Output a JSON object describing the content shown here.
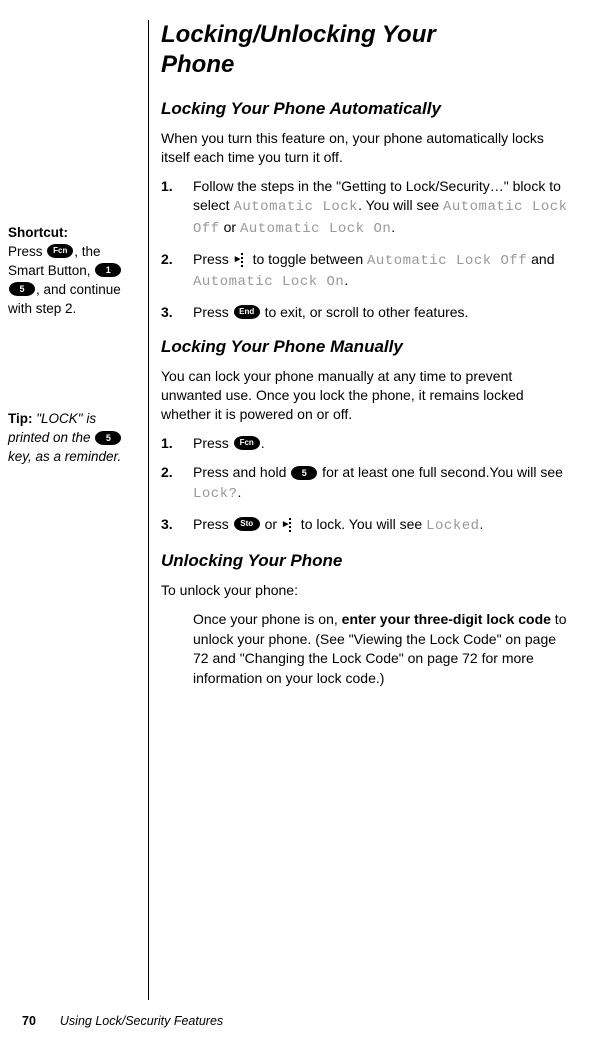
{
  "title_line1": "Locking/Unlocking Your",
  "title_line2": "Phone",
  "section1": {
    "heading": "Locking Your Phone Automatically",
    "intro": "When you turn this feature on, your phone automatically locks itself each time you turn it off.",
    "steps": [
      {
        "num": "1.",
        "pre": "Follow the steps in the \"Getting to Lock/Security…\" block to select ",
        "code1": "Automatic Lock",
        "mid": ". You will see ",
        "code2": "Automatic Lock Off",
        "mid2": " or ",
        "code3": "Automatic Lock On",
        "post": "."
      },
      {
        "num": "2.",
        "pre": "Press ",
        "mid": " to toggle between ",
        "code1": "Automatic Lock Off",
        "mid2": " and ",
        "code2": "Automatic Lock On",
        "post": "."
      },
      {
        "num": "3.",
        "pre": "Press ",
        "key": "End",
        "post": " to exit, or scroll to other features."
      }
    ]
  },
  "section2": {
    "heading": "Locking Your Phone Manually",
    "intro": "You can lock your phone manually at any time to prevent unwanted use. Once you lock the phone, it remains locked whether it is powered on or off.",
    "steps": [
      {
        "num": "1.",
        "pre": "Press ",
        "key": "Fcn",
        "post": "."
      },
      {
        "num": "2.",
        "pre": "Press and hold ",
        "key": "5",
        "mid": " for at least one full second.You will see ",
        "code": "Lock?",
        "post": "."
      },
      {
        "num": "3.",
        "pre": "Press ",
        "key": "Sto",
        "mid": " or ",
        "mid2": " to lock. You will see ",
        "code": "Locked",
        "post": "."
      }
    ]
  },
  "section3": {
    "heading": "Unlocking Your Phone",
    "intro": "To unlock your phone:",
    "para_pre": "Once your phone is on, ",
    "para_bold": "enter your three-digit lock code",
    "para_post": " to unlock your phone. (See \"Viewing the Lock Code\" on page 72 and \"Changing the Lock Code\" on page 72 for more information on your lock code.)"
  },
  "sidebar": {
    "shortcut_label": "Shortcut:",
    "shortcut_pre": "Press ",
    "shortcut_key1": "Fcn",
    "shortcut_mid1": ", the Smart Button, ",
    "shortcut_key2": "1",
    "shortcut_key3": "5",
    "shortcut_post": ", and continue with step 2.",
    "tip_label": "Tip:",
    "tip_pre": " \"LOCK\" is printed on the ",
    "tip_key": "5",
    "tip_post": " key, as a reminder."
  },
  "footer": {
    "page_num": "70",
    "section": "Using Lock/Security Features"
  }
}
